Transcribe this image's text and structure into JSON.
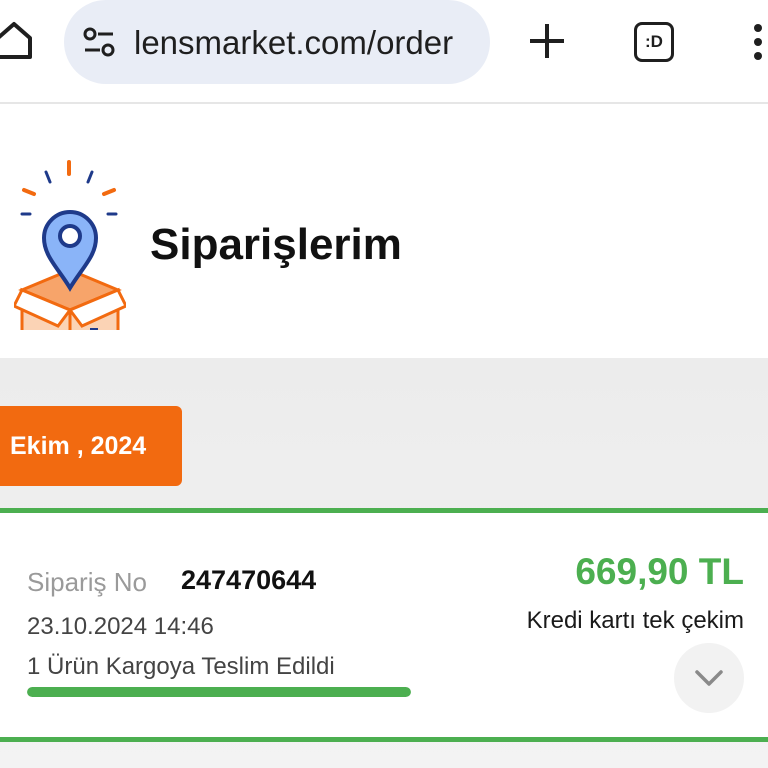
{
  "browser": {
    "url": "lensmarket.com/order",
    "tab_indicator": ":D"
  },
  "page": {
    "title": "Siparişlerim"
  },
  "orders_section": {
    "month_label": "Ekim , 2024",
    "order": {
      "number_label": "Sipariş No",
      "number_value": "247470644",
      "date": "23.10.2024 14:46",
      "status": "1 Ürün Kargoya Teslim Edildi",
      "status_progress": 1.0,
      "total": "669,90 TL",
      "payment_method": "Kredi kartı tek çekim"
    }
  },
  "colors": {
    "accent_orange": "#f26a10",
    "success_green": "#4caf50",
    "url_bar_bg": "#e9edf6"
  },
  "icons": [
    "home-icon",
    "site-settings-icon",
    "plus-icon",
    "tabs-icon",
    "more-vert-icon",
    "delivery-box-icon",
    "chevron-down-icon"
  ]
}
